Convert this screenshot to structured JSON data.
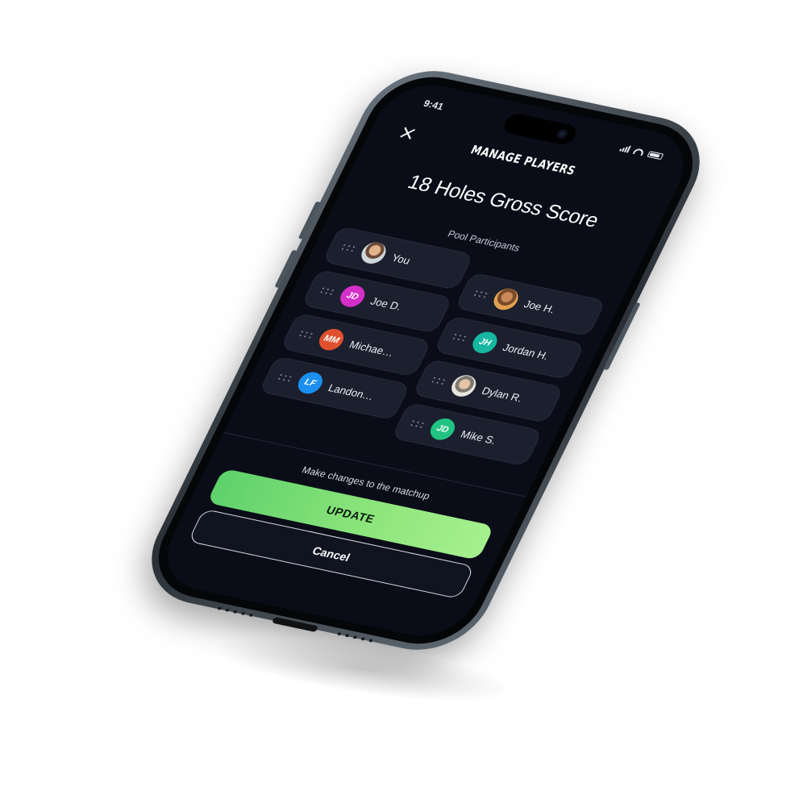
{
  "status_bar": {
    "time": "9:41"
  },
  "header": {
    "title": "MANAGE PLAYERS",
    "close_icon": "close-icon"
  },
  "pool": {
    "title": "18 Holes Gross Score",
    "section_label": "Pool Participants"
  },
  "participants": [
    {
      "name": "You",
      "initials": "",
      "avatar_color": "#8a8f99",
      "photo": "photo"
    },
    {
      "name": "Joe H.",
      "initials": "",
      "avatar_color": "#c47a3c",
      "photo": "photo2"
    },
    {
      "name": "Joe D.",
      "initials": "JD",
      "avatar_color": "#d42fc9",
      "photo": ""
    },
    {
      "name": "Jordan H.",
      "initials": "JH",
      "avatar_color": "#16b6a0",
      "photo": ""
    },
    {
      "name": "Michae…",
      "initials": "MM",
      "avatar_color": "#e0502e",
      "photo": ""
    },
    {
      "name": "Dylan R.",
      "initials": "",
      "avatar_color": "#a09a91",
      "photo": "photo3"
    },
    {
      "name": "Landon…",
      "initials": "LF",
      "avatar_color": "#1b8ff0",
      "photo": ""
    },
    {
      "name": "Mike S.",
      "initials": "JD",
      "avatar_color": "#22c382",
      "photo": ""
    }
  ],
  "footer": {
    "note": "Make changes to the matchup",
    "update_label": "UPDATE",
    "cancel_label": "Cancel"
  },
  "colors": {
    "screen_bg": "#0a0d18",
    "chip_bg": "#1b1f2e",
    "update_green": "#7fdc72"
  }
}
